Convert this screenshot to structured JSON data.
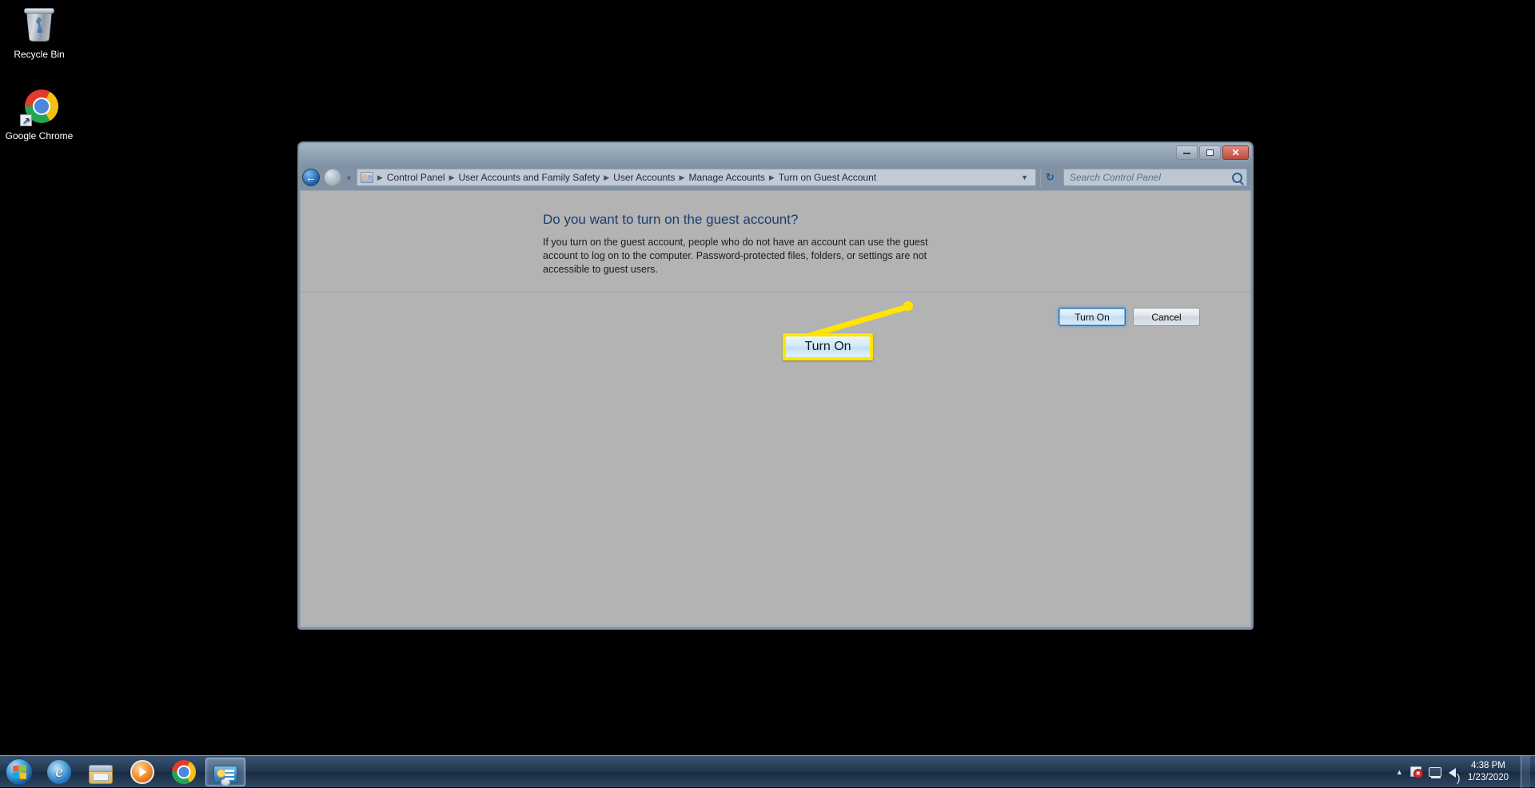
{
  "desktop": {
    "icons": [
      {
        "label": "Recycle Bin",
        "icon": "recycle-bin-icon"
      },
      {
        "label": "Google Chrome",
        "icon": "google-chrome-icon"
      }
    ]
  },
  "window": {
    "title": "",
    "controls": {
      "minimize": "minimize-button",
      "maximize": "maximize-button",
      "close": "close-button",
      "close_glyph": "✕"
    },
    "nav": {
      "back": "back-button",
      "forward": "forward-button",
      "recent_pages": "recent-pages-chevron",
      "refresh_glyph": "↻"
    },
    "breadcrumbs": [
      "Control Panel",
      "User Accounts and Family Safety",
      "User Accounts",
      "Manage Accounts",
      "Turn on Guest Account"
    ],
    "breadcrumb_separator": "▶",
    "address_dropdown_glyph": "▼",
    "search": {
      "placeholder": "Search Control Panel",
      "value": ""
    }
  },
  "main": {
    "heading": "Do you want to turn on the guest account?",
    "description": "If you turn on the guest account, people who do not have an account can use the guest account to log on to the computer. Password-protected files, folders, or settings are not accessible to guest users.",
    "buttons": {
      "primary": "Turn On",
      "secondary": "Cancel"
    }
  },
  "annotation": {
    "callout_label": "Turn On",
    "border_color": "#ffe500",
    "line_color": "#ffe500"
  },
  "taskbar": {
    "start": "start-orb",
    "items": [
      {
        "name": "internet-explorer",
        "active": false
      },
      {
        "name": "windows-explorer",
        "active": false
      },
      {
        "name": "windows-media-player",
        "active": false
      },
      {
        "name": "google-chrome",
        "active": false
      },
      {
        "name": "control-panel",
        "active": true
      }
    ],
    "tray": {
      "show_hidden_glyph": "▲",
      "icons": [
        "action-center-flag-icon",
        "network-icon",
        "volume-icon"
      ],
      "time": "4:38 PM",
      "date": "1/23/2020"
    }
  }
}
